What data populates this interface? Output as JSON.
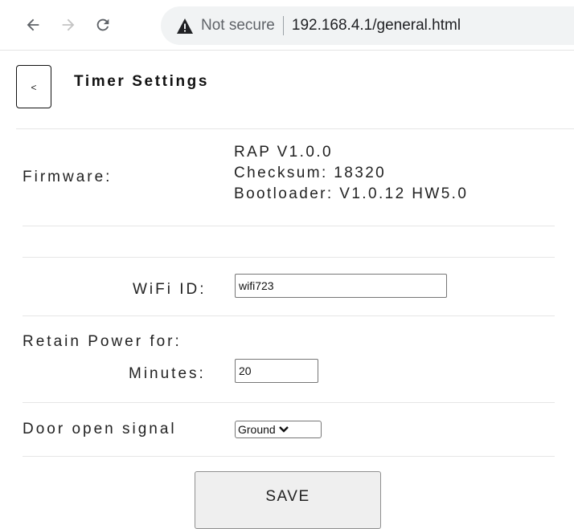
{
  "browser": {
    "back_icon": "arrow-left-icon",
    "forward_icon": "arrow-right-icon",
    "reload_icon": "reload-icon",
    "security_icon": "warning-triangle-icon",
    "security_label": "Not secure",
    "url": "192.168.4.1/general.html"
  },
  "header": {
    "back_label": "<",
    "title": "Timer Settings"
  },
  "firmware": {
    "label": "Firmware:",
    "version": "RAP V1.0.0",
    "checksum": "Checksum: 18320",
    "bootloader": "Bootloader: V1.0.12 HW5.0"
  },
  "wifi": {
    "label": "WiFi ID:",
    "value": "wifi723"
  },
  "retain": {
    "label": "Retain Power for:",
    "minutes_label": "Minutes:",
    "minutes_value": "20"
  },
  "door": {
    "label": "Door open signal",
    "selected": "Ground"
  },
  "actions": {
    "save_label": "SAVE"
  },
  "colors": {
    "chrome_omnibox": "#f1f3f4",
    "divider": "#e6e6e6",
    "button_bg": "#efefef"
  }
}
